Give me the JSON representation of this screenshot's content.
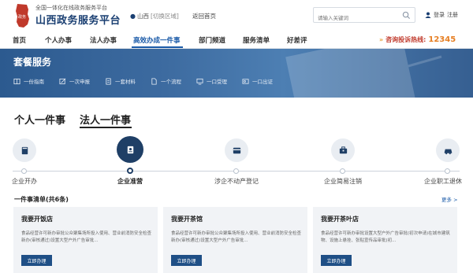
{
  "header": {
    "subtitle": "全国一体化在线政务服务平台",
    "title": "山西政务服务平台",
    "location": "山西",
    "switch_region": "[切换区域]",
    "home_link": "返回首页",
    "search_placeholder": "请输入关键词",
    "login": "登录",
    "register": "注册"
  },
  "nav": {
    "items": [
      "首页",
      "个人办事",
      "法人办事",
      "高效办成一件事",
      "部门频道",
      "服务清单",
      "好差评"
    ],
    "hotline_label": "咨询投诉热线:",
    "hotline_number": "12345"
  },
  "banner": {
    "title": "套餐服务",
    "items": [
      "一份指南",
      "一次申报",
      "一套材料",
      "一个流程",
      "一口受理",
      "一口出证"
    ]
  },
  "tabs": [
    "个人一件事",
    "法人一件事"
  ],
  "steps": [
    "企业开办",
    "企业准营",
    "涉企不动产登记",
    "企业简易注销",
    "企业职工退休"
  ],
  "list": {
    "title": "一件事清单(共6条)",
    "more": "更多 >",
    "cards": [
      {
        "title": "我要开饭店",
        "desc": "食品经营许可新办审批公众聚集场所投入使用、营业前消防安全检查新办(审核通过)设置大型户外广告审批...",
        "button": "立即办理"
      },
      {
        "title": "我要开茶馆",
        "desc": "食品经营许可新办审批公众聚集场所投入使用、营业前消防安全检查新办(审核通过)设置大型户外广告审批...",
        "button": "立即办理"
      },
      {
        "title": "我要开茶叶店",
        "desc": "食品经营许可新办审批设置大型户外广告审批(初次申请)在城市建筑物、设施上悬挂、张贴宣传品审批(初...",
        "button": "立即办理"
      }
    ]
  },
  "colors": {
    "brand": "#1a3f72",
    "accent": "#1a5aa8",
    "hotline": "#e67e22",
    "banner": "#3d6ba0"
  }
}
